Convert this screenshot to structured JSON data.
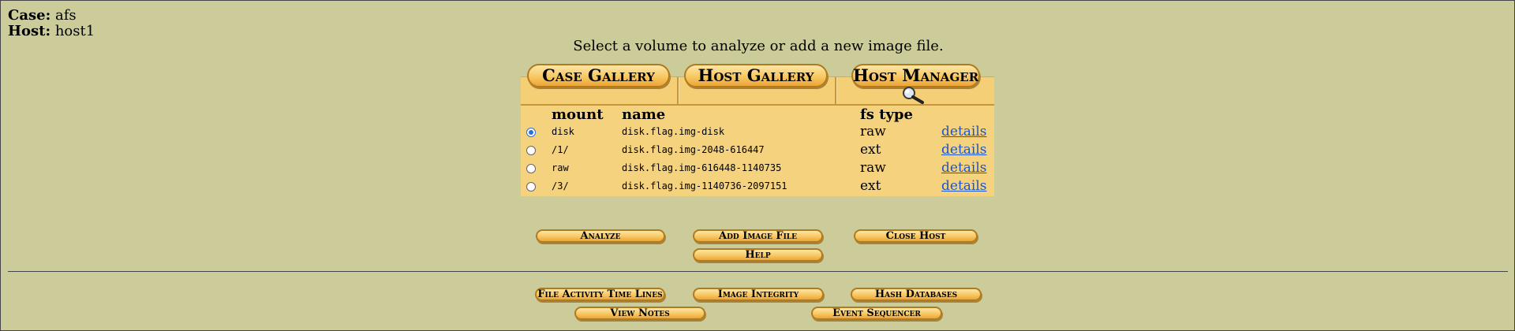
{
  "case": {
    "label": "Case:",
    "value": "afs"
  },
  "host": {
    "label": "Host:",
    "value": "host1"
  },
  "instruction": "Select a volume to analyze or add a new image file.",
  "tabs": [
    {
      "label": "Case Gallery"
    },
    {
      "label": "Host Gallery"
    },
    {
      "label": "Host Manager",
      "active": true
    }
  ],
  "table": {
    "headers": {
      "mount": "mount",
      "name": "name",
      "fs_type": "fs type"
    },
    "rows": [
      {
        "mount": "disk",
        "name": "disk.flag.img-disk",
        "fs_type": "raw",
        "details": "details",
        "selected": true
      },
      {
        "mount": "/1/",
        "name": "disk.flag.img-2048-616447",
        "fs_type": "ext",
        "details": "details",
        "selected": false
      },
      {
        "mount": "raw",
        "name": "disk.flag.img-616448-1140735",
        "fs_type": "raw",
        "details": "details",
        "selected": false
      },
      {
        "mount": "/3/",
        "name": "disk.flag.img-1140736-2097151",
        "fs_type": "ext",
        "details": "details",
        "selected": false
      }
    ]
  },
  "actions": {
    "analyze": "Analyze",
    "add_image": "Add Image File",
    "close_host": "Close Host",
    "help": "Help"
  },
  "tools": {
    "timeline": "File Activity Time Lines",
    "integrity": "Image Integrity",
    "hash_db": "Hash Databases",
    "notes": "View Notes",
    "sequencer": "Event Sequencer"
  },
  "colors": {
    "background": "#cccc9a",
    "panel": "#f5d27d",
    "button": "#f8c862",
    "link": "#1a56c9"
  }
}
